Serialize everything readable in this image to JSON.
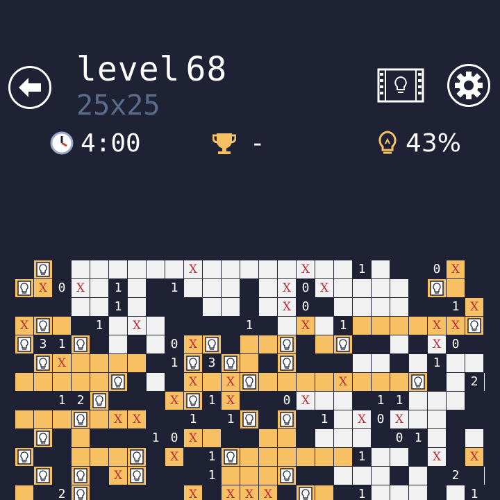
{
  "header": {
    "level_label": "level",
    "level_number": "68",
    "board_size": "25x25"
  },
  "stats": {
    "timer": "4:00",
    "best": "-",
    "hint_percent": "43%"
  },
  "icons": {
    "back": "arrow-left-icon",
    "film": "film-bulb-icon",
    "settings": "gear-icon",
    "timer": "clock-icon",
    "best": "trophy-icon",
    "hint": "lightbulb-icon"
  },
  "colors": {
    "background": "#1f2135",
    "lit_cell": "#f7c062",
    "empty_cell": "#f2f2f2",
    "mark_x": "#c0303a",
    "subtitle": "#5b6c8c"
  },
  "board": {
    "legend": "each row string: d=dark wall, w=white cell, y=lit cell, b=bulb, X=cross on white, Z=cross on lit, 0-4 = numbered wall",
    "rows": [
      "dbdwwwwwwXwwwwwXww1wdd0Zd",
      "bZ0Xw1wd1wwwdwX0Xwwwwdbyd",
      "dddww1wdddwwdwX0dwwwwdd1Z",
      "Zbyd1wXwdddd1dwZw1yyyyZZb",
      "b31bdwdw0ZbdyybdybddwdX0d",
      "dbZyyyyd1b3bydbdddwwdw1ww",
      "yyyyybdwdZyZbyyyyZyyybdw2w",
      "dd12bdddZb1Zdd0Xwwd11www",
      "yyybyZZdd1d1bdbd1wX0Xww",
      "dbdyddd10Zyddyydwwwd01wdw",
      "bddyyybdZd1byyyyyy1wwdXdZ",
      "dbdbdZbddd1yyybddwwwdwd2dw",
      "yd2bdddddZdZZZdbyd1wwwdw1"
    ]
  }
}
